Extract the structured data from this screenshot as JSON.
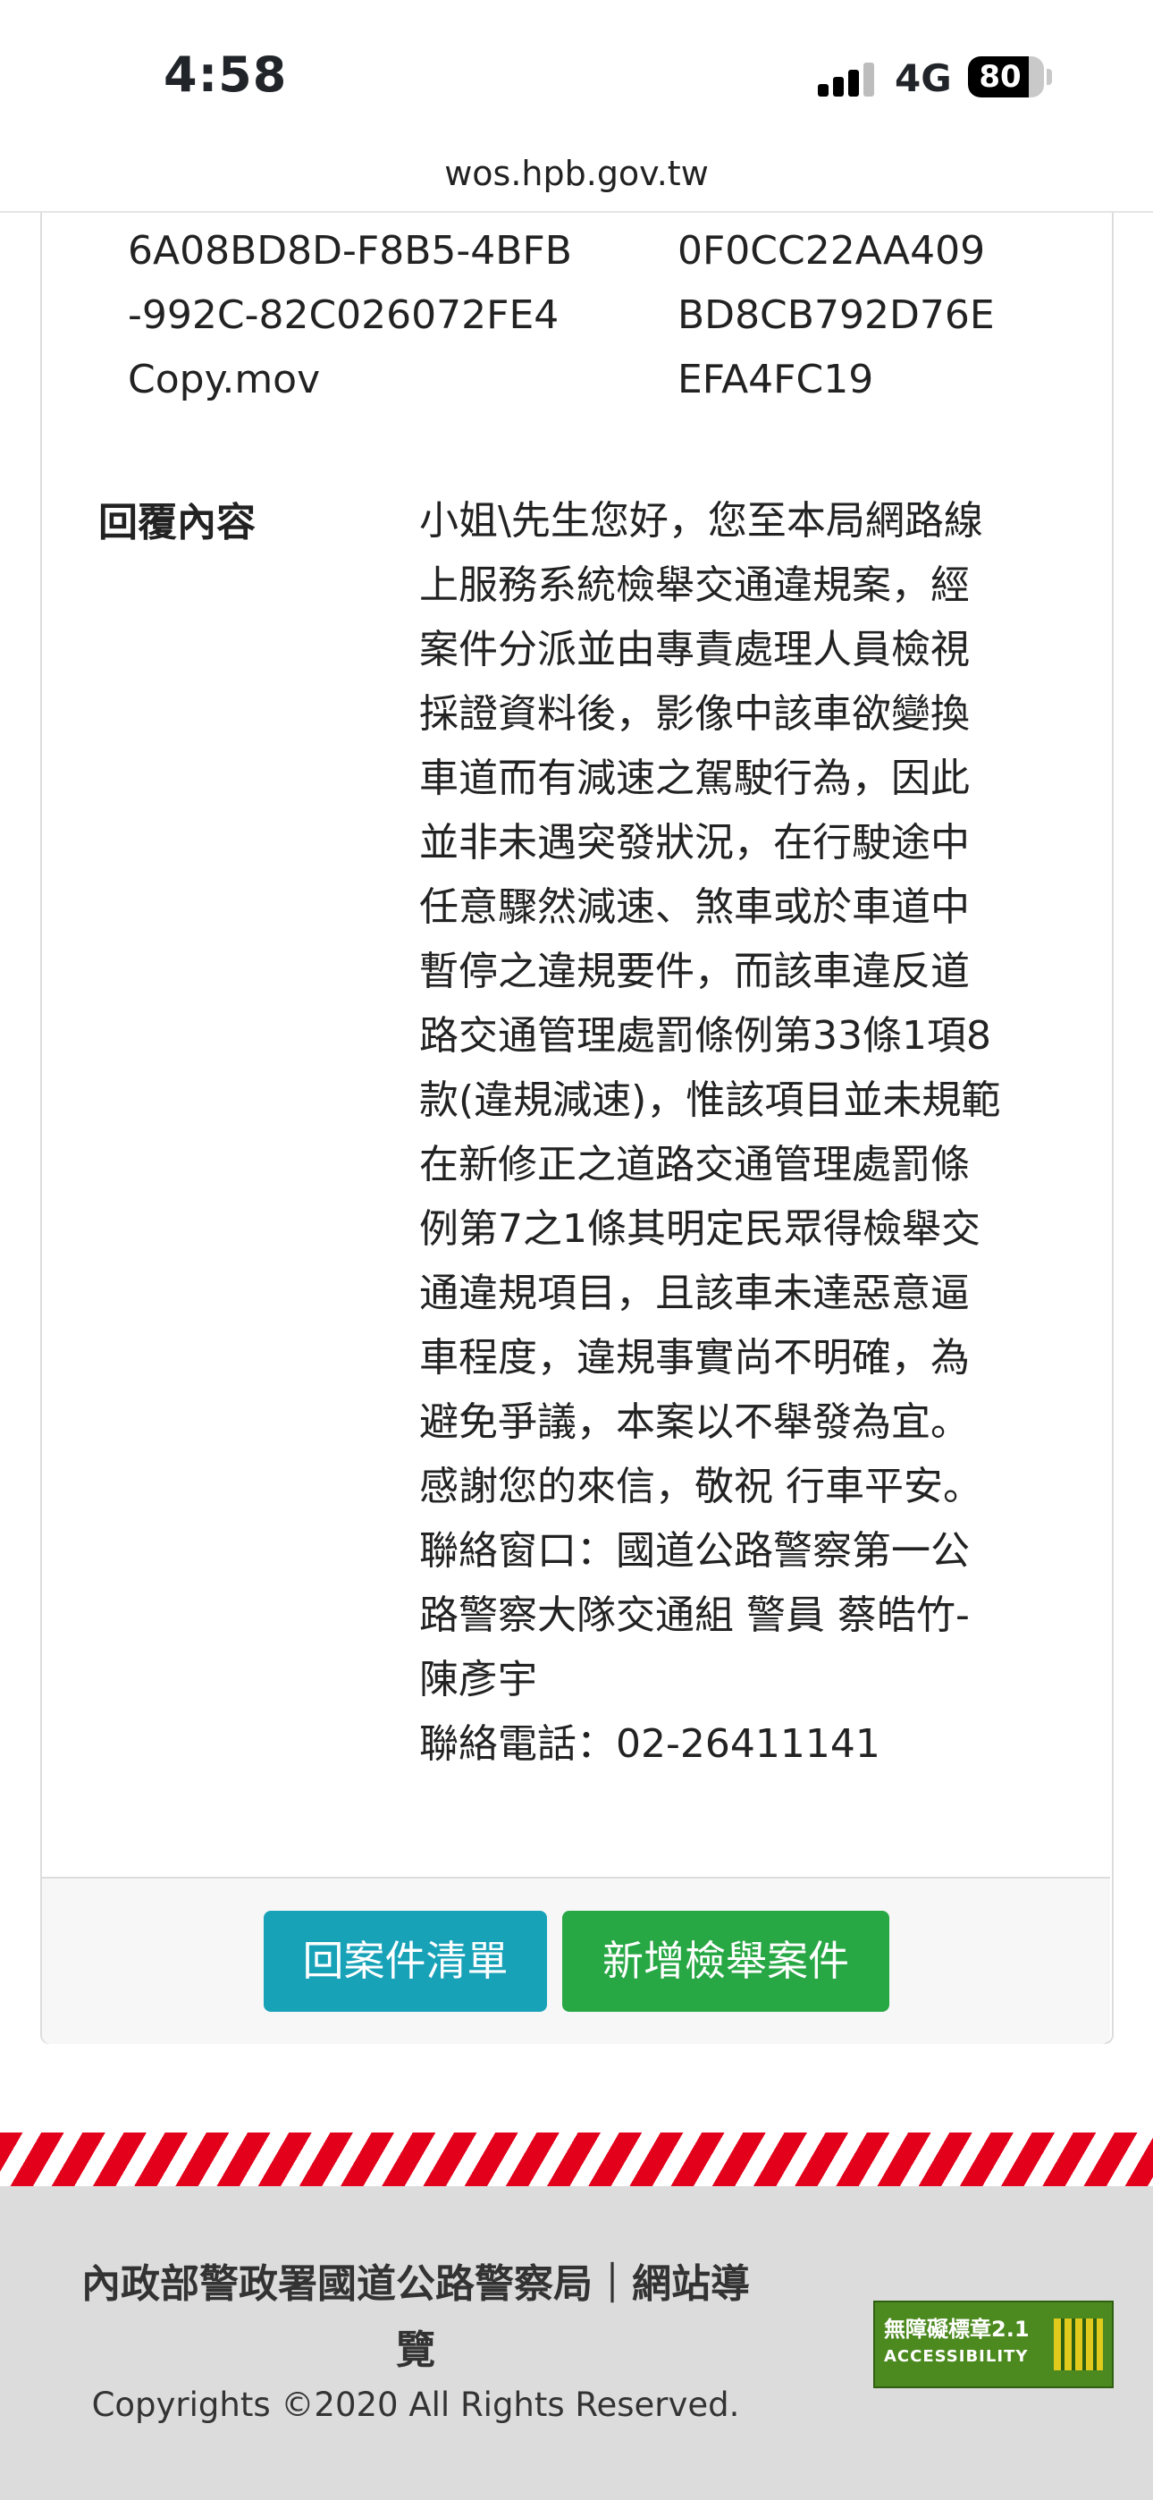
{
  "status_bar": {
    "time": "4:58",
    "network": "4G",
    "battery": "80",
    "battery_level": 0.8
  },
  "browser": {
    "url": "wos.hpb.gov.tw"
  },
  "attachment": {
    "filename_lines": [
      "6A08BD8D-F8B5-4BFB",
      "-992C-82C026072FE4",
      "Copy.mov"
    ],
    "hash_lines": [
      "0F0CC22AA409",
      "BD8CB792D76E",
      "EFA4FC19"
    ]
  },
  "reply": {
    "label": "回覆內容",
    "lines": [
      "小姐\\先生您好，您至本局網路線",
      "上服務系統檢舉交通違規案，經",
      "案件分派並由專責處理人員檢視",
      "採證資料後，影像中該車欲變換",
      "車道而有減速之駕駛行為，因此",
      "並非未遇突發狀況，在行駛途中",
      "任意驟然減速、煞車或於車道中",
      "暫停之違規要件，而該車違反道",
      "路交通管理處罰條例第33條1項8",
      "款(違規減速)，惟該項目並未規範",
      "在新修正之道路交通管理處罰條",
      "例第7之1條其明定民眾得檢舉交",
      "通違規項目，且該車未達惡意逼",
      "車程度，違規事實尚不明確，為",
      "避免爭議，本案以不舉發為宜。",
      "感謝您的來信，敬祝 行車平安。",
      "聯絡窗口：國道公路警察第一公",
      "路警察大隊交通組 警員 蔡皓竹-",
      "陳彥宇",
      "聯絡電話：02-26411141"
    ]
  },
  "buttons": {
    "back_to_list": "回案件清單",
    "new_report": "新增檢舉案件"
  },
  "footer": {
    "org_line1": "內政部警政署國道公路警察局｜網站導",
    "org_line2": "覽",
    "copyright": "Copyrights ©2020 All Rights Reserved.",
    "badge_title": "無障礙標章2.1",
    "badge_sub": "ACCESSIBILITY"
  }
}
